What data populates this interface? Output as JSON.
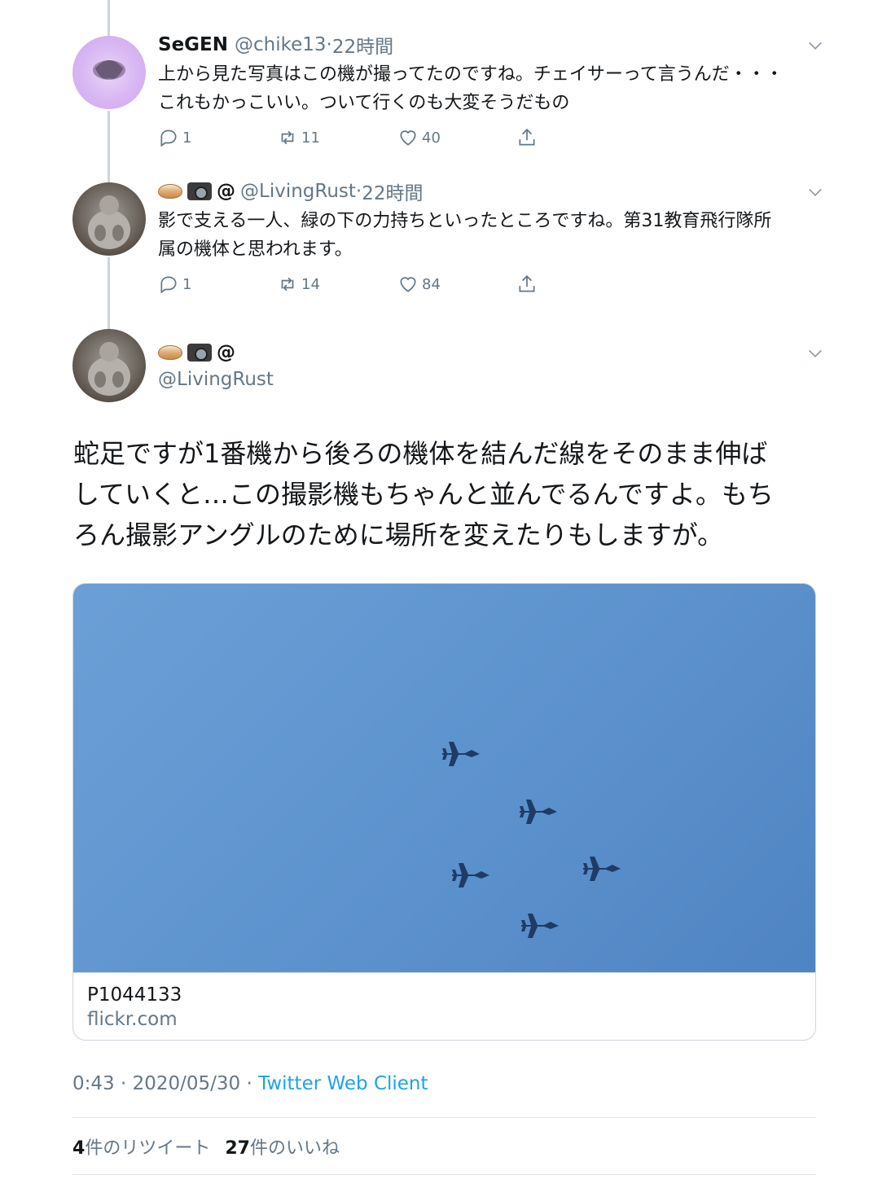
{
  "replies": [
    {
      "name": "SeGEN",
      "handle": "@chike13",
      "time": "22時間",
      "text_line1": "上から見た写真はこの機が撮ってたのですね。チェイサーって言うんだ・・・",
      "text_line2": "これもかっこいい。ついて行くのも大変そうだもの",
      "reply_count": "1",
      "retweet_count": "11",
      "like_count": "40"
    },
    {
      "display_at": "@",
      "handle": "@LivingRust",
      "time": "22時間",
      "text_line1": "影で支える一人、緑の下の力持ちといったところですね。第31教育飛行隊所",
      "text_line2": "属の機体と思われます。",
      "reply_count": "1",
      "retweet_count": "14",
      "like_count": "84"
    }
  ],
  "main_tweet": {
    "display_at": "@",
    "handle": "@LivingRust",
    "line1": "蛇足ですが1番機から後ろの機体を結んだ線をそのまま伸ば",
    "line2": "していくと…この撮影機もちゃんと並んでるんですよ。もち",
    "line3": "ろん撮影アングルのために場所を変えたりもしますが。",
    "card": {
      "title": "P1044133",
      "domain": "flickr.com"
    },
    "time": "0:43 · 2020/05/30 · ",
    "client": "Twitter Web Client",
    "retweets_num": "4",
    "retweets_label": "件のリツイート",
    "likes_num": "27",
    "likes_label": "件のいいね"
  },
  "icons": [
    "reply-icon",
    "retweet-icon",
    "like-icon",
    "share-icon",
    "chevron-down-icon",
    "bowl-emoji-icon",
    "camera-emoji-icon"
  ],
  "colors": {
    "text": "#14171a",
    "muted": "#657786",
    "link": "#1da1f2",
    "border": "#ccd6dd",
    "sky": "#5f95cf"
  }
}
